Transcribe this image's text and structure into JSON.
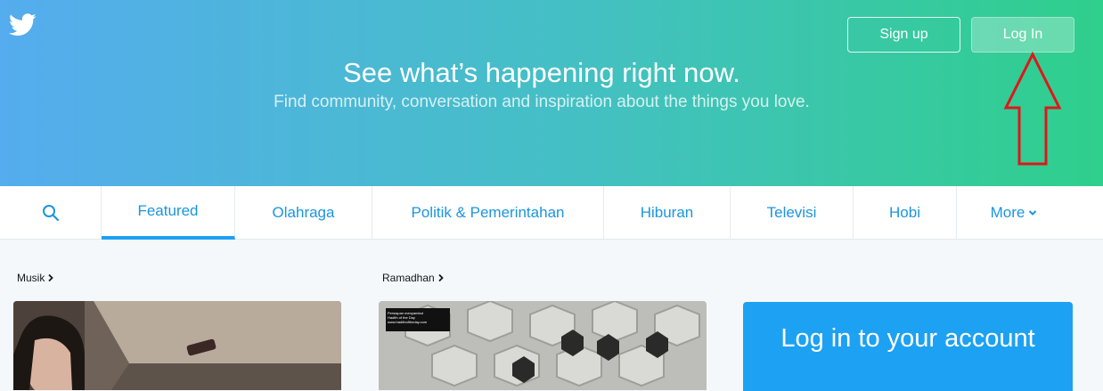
{
  "header": {
    "signup_label": "Sign up",
    "login_label": "Log In",
    "title": "See what’s happening right now.",
    "subtitle": "Find community, conversation and inspiration about the things you love."
  },
  "nav": {
    "items": [
      {
        "label": "Featured"
      },
      {
        "label": "Olahraga"
      },
      {
        "label": "Politik & Pemerintahan"
      },
      {
        "label": "Hiburan"
      },
      {
        "label": "Televisi"
      },
      {
        "label": "Hobi"
      },
      {
        "label": "More"
      }
    ]
  },
  "sections": [
    {
      "label": "Musik"
    },
    {
      "label": "Ramadhan"
    }
  ],
  "ramadhan_card": {
    "overlay_lines": [
      "Persiapan menyambut",
      "Hadith of the Day",
      "www.hadithoftheday.com"
    ]
  },
  "login_panel": {
    "title": "Log in to your account"
  },
  "colors": {
    "accent": "#1da1f2",
    "link": "#1b95e0",
    "annotation_arrow": "#e0161b"
  }
}
